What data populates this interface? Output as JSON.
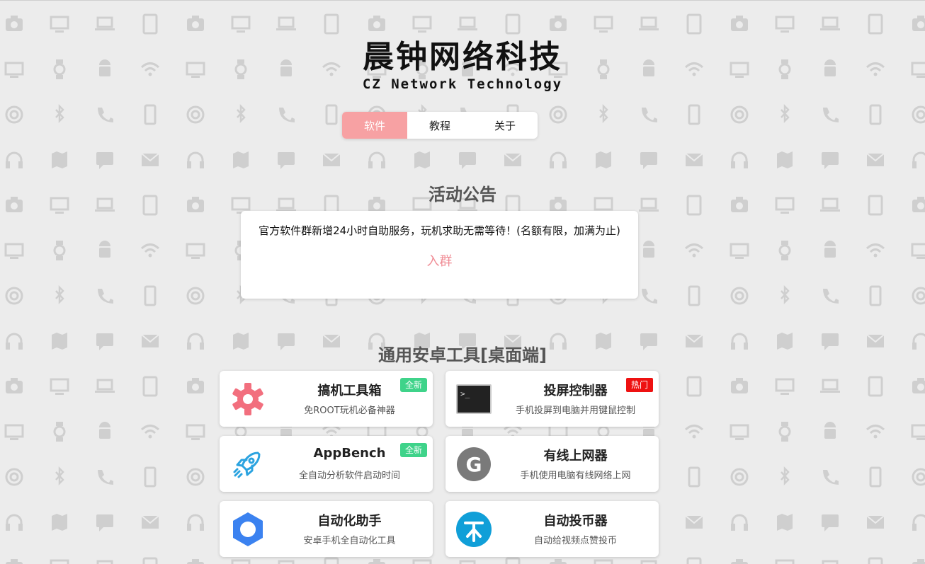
{
  "logo": {
    "cn": "晨钟网络科技",
    "en": "CZ Network Technology"
  },
  "nav": {
    "tabs": [
      {
        "label": "软件",
        "active": true
      },
      {
        "label": "教程",
        "active": false
      },
      {
        "label": "关于",
        "active": false
      }
    ]
  },
  "notice": {
    "title": "活动公告",
    "text": "官方软件群新增24小时自助服务，玩机求助无需等待！(名额有限，加满为止)",
    "link": "入群"
  },
  "tools": {
    "title": "通用安卓工具[桌面端]",
    "cards": [
      {
        "title": "搞机工具箱",
        "desc": "免ROOT玩机必备神器",
        "badge": "全新",
        "badge_color": "#3fd38a",
        "icon": "gear-icon"
      },
      {
        "title": "投屏控制器",
        "desc": "手机投屏到电脑并用键鼠控制",
        "badge": "热门",
        "badge_color": "#ee1111",
        "icon": "terminal-icon"
      },
      {
        "title": "AppBench",
        "desc": "全自动分析软件启动时间",
        "badge": "全新",
        "badge_color": "#3fd38a",
        "icon": "rocket-icon"
      },
      {
        "title": "有线上网器",
        "desc": "手机使用电脑有线网络上网",
        "badge": "",
        "icon": "g-logo-icon"
      },
      {
        "title": "自动化助手",
        "desc": "安卓手机全自动化工具",
        "badge": "",
        "icon": "hexagon-icon"
      },
      {
        "title": "自动投币器",
        "desc": "自动给视频点赞投币",
        "badge": "",
        "icon": "coin-icon"
      }
    ]
  },
  "colors": {
    "accent": "#f7a1a3",
    "link": "#f08c95",
    "badge_new": "#3fd38a",
    "badge_hot": "#ee1111",
    "background": "#ececec"
  }
}
